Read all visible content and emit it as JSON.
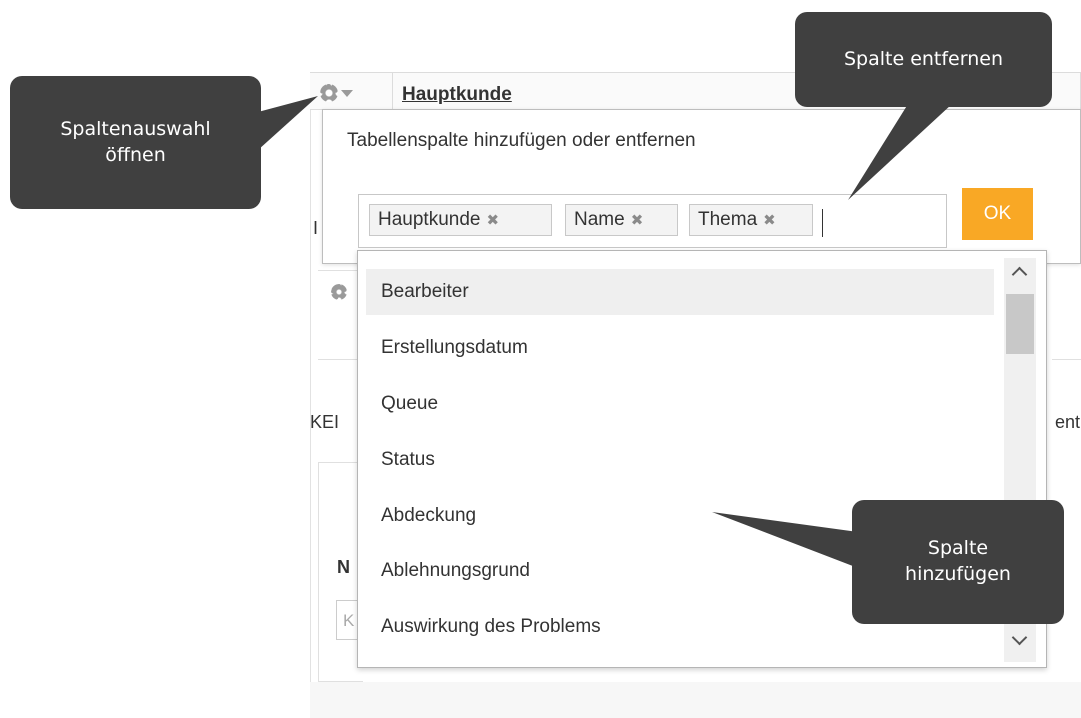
{
  "table": {
    "header_title": "Hauptkunde",
    "fragment_kei": "KEI",
    "fragment_ent": "ent",
    "fragment_n": "N",
    "fragment_k": "K",
    "fragment_i": "I"
  },
  "modal": {
    "title": "Tabellenspalte hinzufügen oder entfernen",
    "tags": [
      {
        "label": "Hauptkunde",
        "remove": "✖"
      },
      {
        "label": "Name",
        "remove": "✖"
      },
      {
        "label": "Thema",
        "remove": "✖"
      }
    ],
    "ok_label": "OK"
  },
  "dropdown": {
    "items": [
      {
        "label": "Bearbeiter",
        "active": true
      },
      {
        "label": "Erstellungsdatum"
      },
      {
        "label": "Queue"
      },
      {
        "label": "Status"
      },
      {
        "label": "Abdeckung"
      },
      {
        "label": "Ablehnungsgrund"
      },
      {
        "label": "Auswirkung des Problems"
      }
    ]
  },
  "callouts": {
    "open_columns": {
      "line1": "Spaltenauswahl",
      "line2": "öffnen"
    },
    "remove_column": "Spalte entfernen",
    "add_column": {
      "line1": "Spalte",
      "line2": "hinzufügen"
    }
  },
  "colors": {
    "ok_button": "#f9a825",
    "callout_bg": "#404040",
    "active_item_bg": "#efefef"
  },
  "icons": {
    "column_settings": "gear-icon",
    "column_settings_caret": "caret-down-icon",
    "tag_remove": "close-icon",
    "scroll_up": "chevron-up-icon",
    "scroll_down": "chevron-down-icon"
  }
}
